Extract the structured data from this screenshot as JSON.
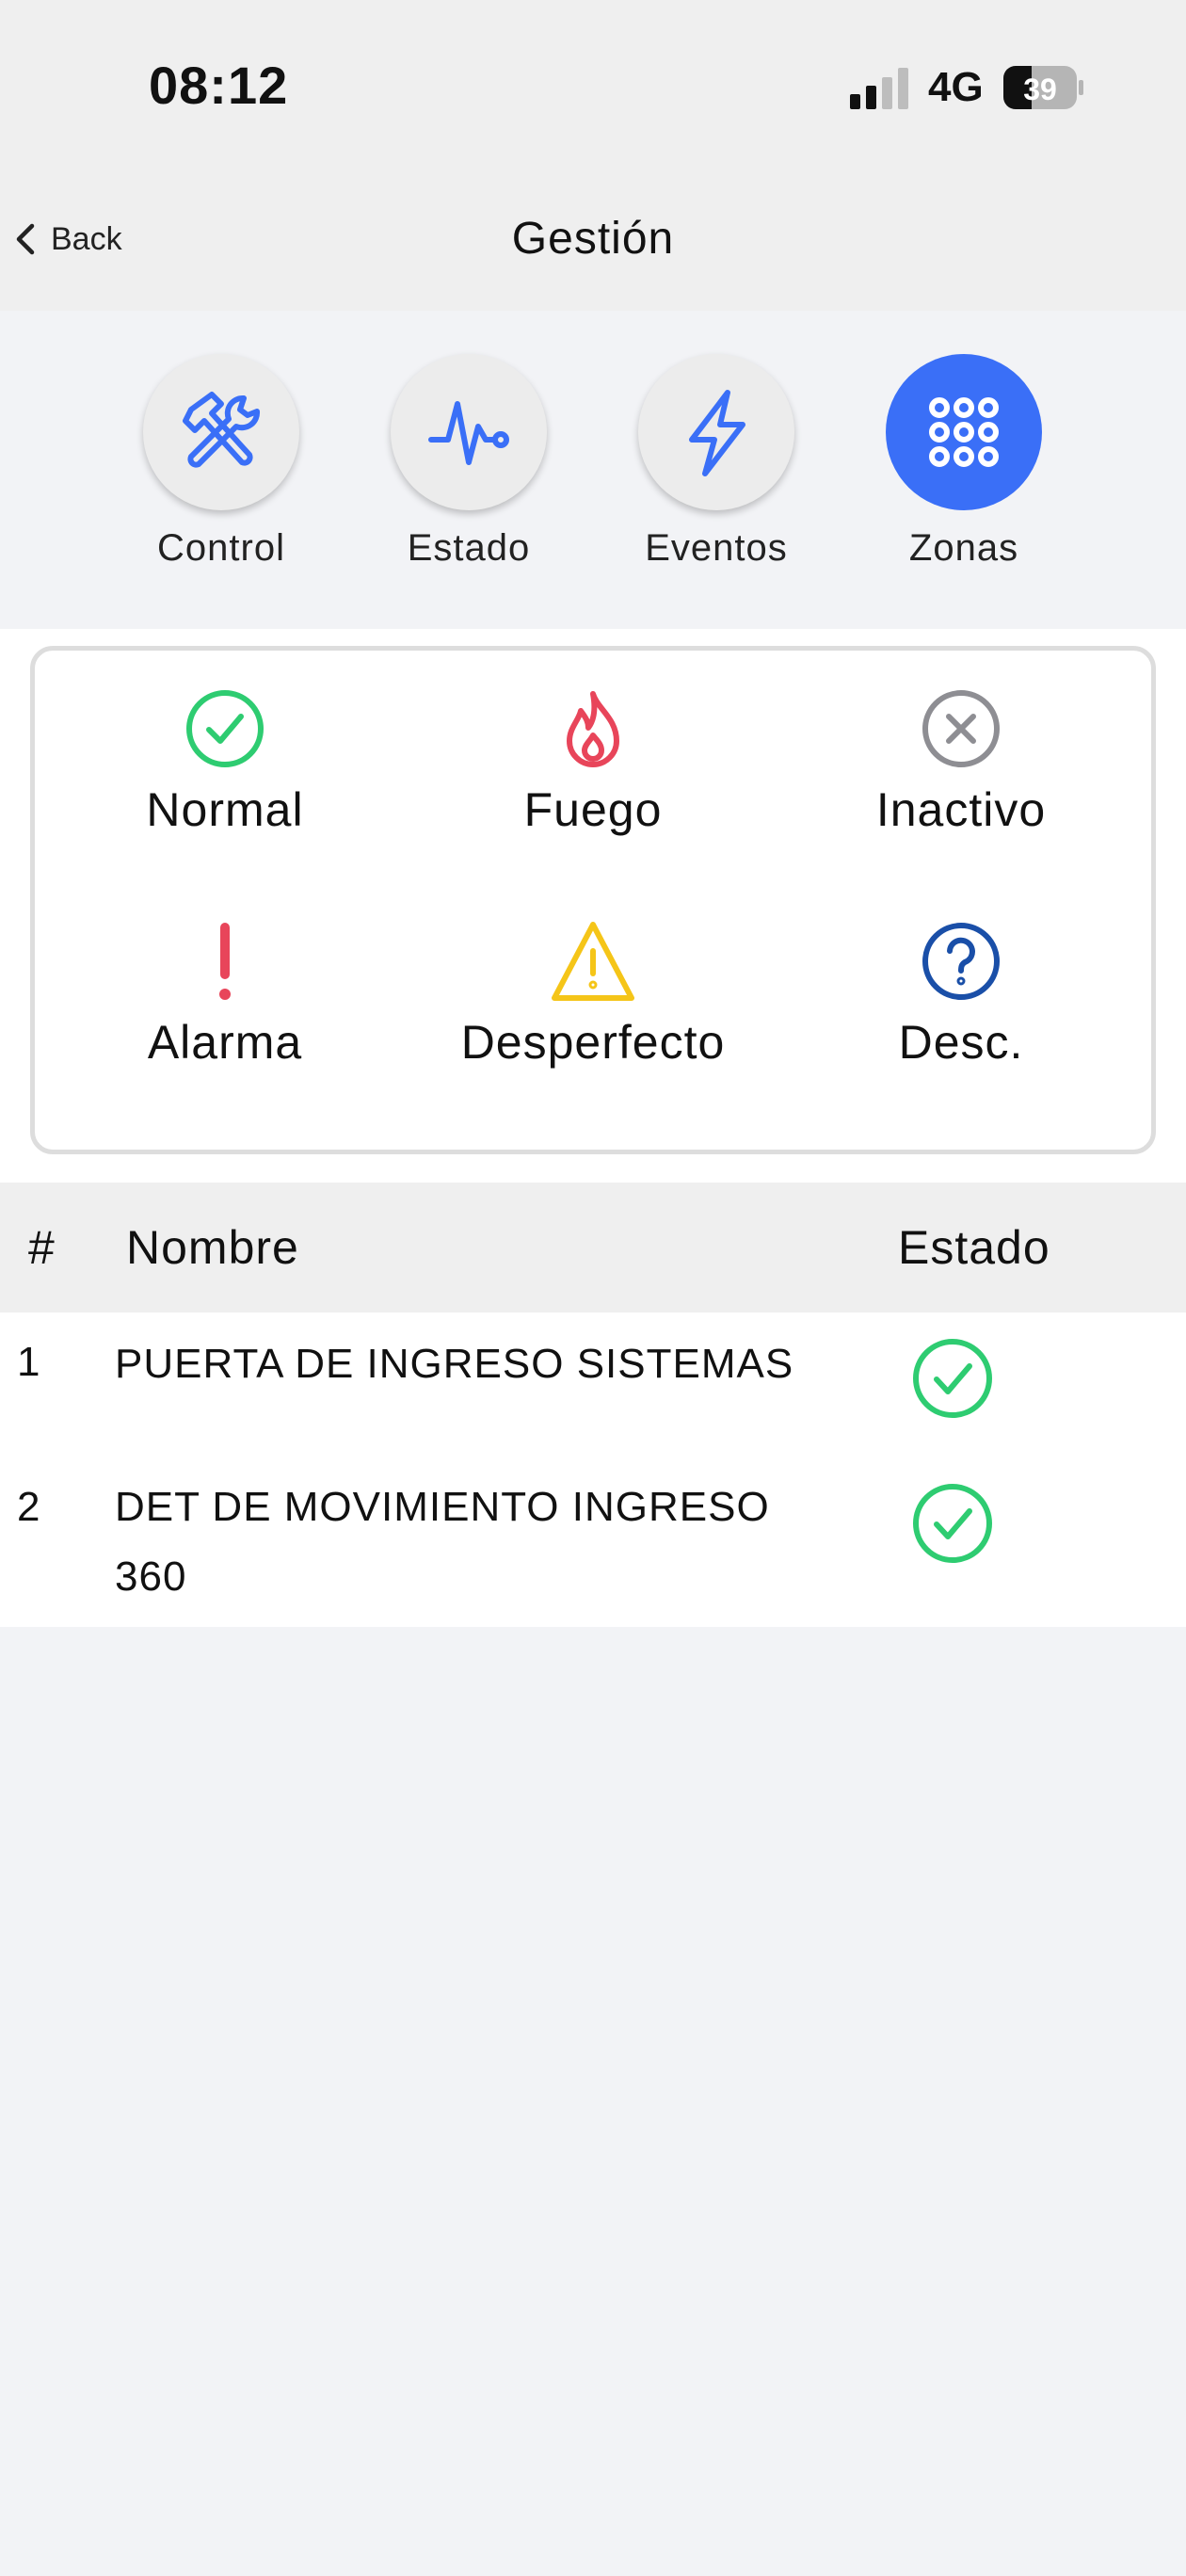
{
  "status_bar": {
    "time": "08:12",
    "network": "4G",
    "battery": "39",
    "icons": [
      "signal-icon",
      "battery-icon"
    ]
  },
  "nav": {
    "back_label": "Back",
    "title": "Gestión"
  },
  "tabs": [
    {
      "label": "Control",
      "icon": "tools-icon",
      "active": false
    },
    {
      "label": "Estado",
      "icon": "pulse-icon",
      "active": false
    },
    {
      "label": "Eventos",
      "icon": "lightning-icon",
      "active": false
    },
    {
      "label": "Zonas",
      "icon": "grid-dots-icon",
      "active": true
    }
  ],
  "legend": [
    {
      "label": "Normal",
      "icon": "check-circle-icon",
      "color": "#2ecc71"
    },
    {
      "label": "Fuego",
      "icon": "flame-icon",
      "color": "#e8455a"
    },
    {
      "label": "Inactivo",
      "icon": "x-circle-icon",
      "color": "#8e8e93"
    },
    {
      "label": "Alarma",
      "icon": "exclamation-icon",
      "color": "#e8455a"
    },
    {
      "label": "Desperfecto",
      "icon": "warning-triangle-icon",
      "color": "#f5c518"
    },
    {
      "label": "Desc.",
      "icon": "question-circle-icon",
      "color": "#1a4fa8"
    }
  ],
  "table": {
    "headers": {
      "num": "#",
      "name": "Nombre",
      "status": "Estado"
    },
    "rows": [
      {
        "num": "1",
        "name": "PUERTA DE INGRESO SISTEMAS",
        "status": "Normal"
      },
      {
        "num": "2",
        "name": "DET DE MOVIMIENTO INGRESO 360",
        "status": "Normal"
      }
    ]
  },
  "colors": {
    "accent": "#3a6ff7",
    "normal": "#2ecc71"
  }
}
